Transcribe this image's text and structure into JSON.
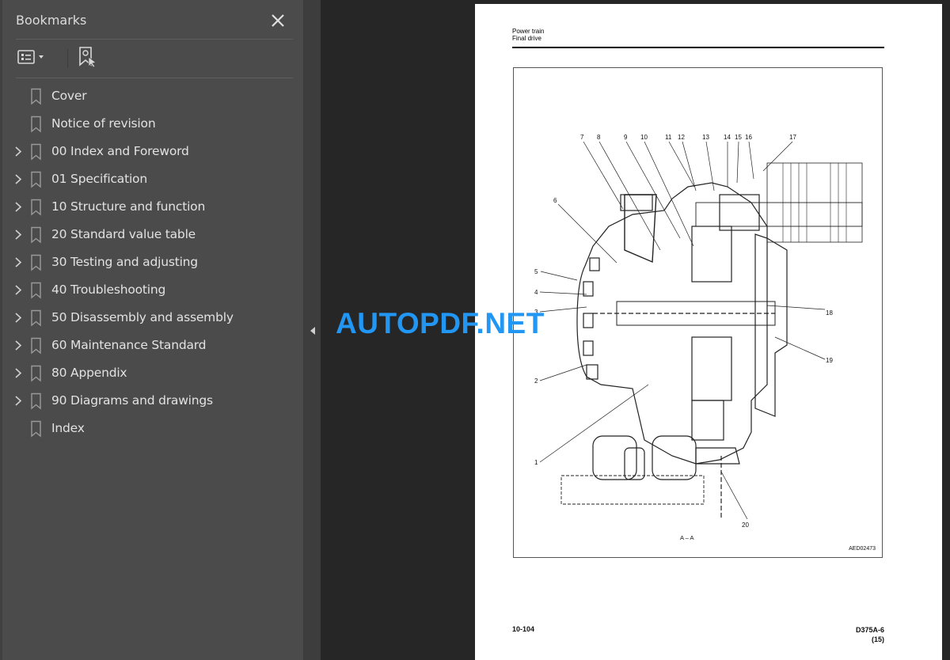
{
  "sidebar": {
    "title": "Bookmarks",
    "close_icon": "close-icon",
    "toolbar": {
      "options_icon": "list-options-icon",
      "find_icon": "find-current-bookmark-icon"
    },
    "items": [
      {
        "label": "Cover",
        "expandable": false
      },
      {
        "label": "Notice of revision",
        "expandable": false
      },
      {
        "label": "00 Index and Foreword",
        "expandable": true
      },
      {
        "label": "01 Specification",
        "expandable": true
      },
      {
        "label": "10 Structure and function",
        "expandable": true
      },
      {
        "label": "20 Standard value table",
        "expandable": true
      },
      {
        "label": "30 Testing and adjusting",
        "expandable": true
      },
      {
        "label": "40 Troubleshooting",
        "expandable": true
      },
      {
        "label": "50 Disassembly and assembly",
        "expandable": true
      },
      {
        "label": "60 Maintenance Standard",
        "expandable": true
      },
      {
        "label": "80 Appendix",
        "expandable": true
      },
      {
        "label": "90 Diagrams and drawings",
        "expandable": true
      },
      {
        "label": "Index",
        "expandable": false
      }
    ]
  },
  "page": {
    "header_line1": "Power train",
    "header_line2": "Final drive",
    "figure": {
      "section_label": "A – A",
      "figure_id": "AED02473",
      "callouts": [
        "1",
        "2",
        "3",
        "4",
        "5",
        "6",
        "7",
        "8",
        "9",
        "10",
        "11",
        "12",
        "13",
        "14",
        "15",
        "16",
        "17",
        "18",
        "19",
        "20"
      ]
    },
    "footer_page": "10-104",
    "footer_model": "D375A-6",
    "footer_revision": "(15)"
  },
  "watermark": "AUTOPDF.NET",
  "colors": {
    "sidebar_bg": "#4b4b4b",
    "viewer_bg": "#262626",
    "watermark": "#2196f3"
  }
}
